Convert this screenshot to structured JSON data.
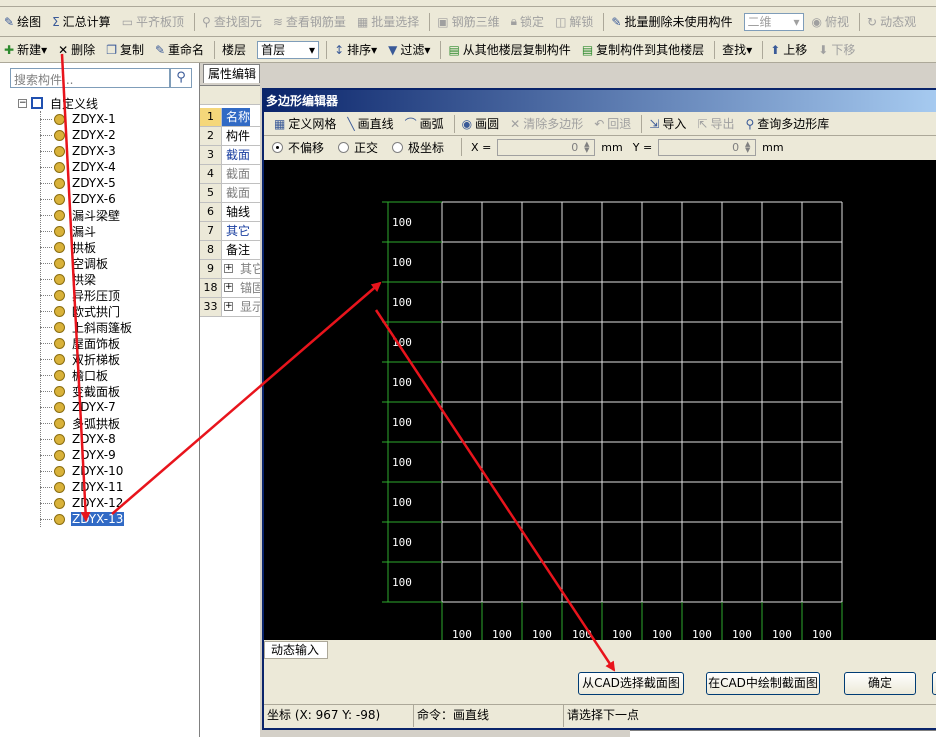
{
  "toolbar1": [
    {
      "name": "draw-button",
      "icon": "pencil-icon",
      "label": "绘图",
      "disabled": false
    },
    {
      "name": "summary-calc-button",
      "icon": "sigma-icon",
      "label": "汇总计算",
      "disabled": false
    },
    {
      "name": "flat-slab-top-button",
      "icon": "slab-icon",
      "label": "平齐板顶",
      "disabled": true
    },
    {
      "name": "find-element-button",
      "icon": "binoculars-icon",
      "label": "查找图元",
      "disabled": true
    },
    {
      "name": "view-rebar-button",
      "icon": "rebar-icon",
      "label": "查看钢筋量",
      "disabled": true
    },
    {
      "name": "batch-select-button",
      "icon": "batch-icon",
      "label": "批量选择",
      "disabled": true
    },
    {
      "name": "rebar-3d-button",
      "icon": "cube-icon",
      "label": "钢筋三维",
      "disabled": true
    },
    {
      "name": "lock-button",
      "icon": "lock-icon",
      "label": "锁定",
      "disabled": true
    },
    {
      "name": "unlock-button",
      "icon": "unlock-icon",
      "label": "解锁",
      "disabled": true
    },
    {
      "name": "batch-delete-unused-button",
      "icon": "delete-batch-icon",
      "label": "批量删除未使用构件",
      "disabled": false
    },
    {
      "name": "view-mode-combo",
      "icon": "",
      "label": "二维",
      "disabled": true,
      "combo": true
    },
    {
      "name": "top-view-button",
      "icon": "eye-icon",
      "label": "俯视",
      "disabled": true
    },
    {
      "name": "dynamic-observe-button",
      "icon": "rotate-icon",
      "label": "动态观",
      "disabled": true
    }
  ],
  "toolbar2": {
    "new_label": "新建",
    "delete_label": "删除",
    "copy_label": "复制",
    "rename_label": "重命名",
    "floor_label": "楼层",
    "floor_value": "首层",
    "sort_label": "排序",
    "filter_label": "过滤",
    "copy_from_floor_label": "从其他楼层复制构件",
    "copy_to_floor_label": "复制构件到其他楼层",
    "find_label": "查找",
    "move_up_label": "上移",
    "move_down_label": "下移"
  },
  "left": {
    "search_placeholder": "搜索构件...",
    "tree_root": "自定义线",
    "items": [
      "ZDYX-1",
      "ZDYX-2",
      "ZDYX-3",
      "ZDYX-4",
      "ZDYX-5",
      "ZDYX-6",
      "漏斗梁壁",
      "漏斗",
      "拱板",
      "空调板",
      "拱梁",
      "异形压顶",
      "欧式拱门",
      "上斜雨篷板",
      "屋面饰板",
      "双折梯板",
      "檐口板",
      "变截面板",
      "ZDYX-7",
      "多弧拱板",
      "ZDYX-8",
      "ZDYX-9",
      "ZDYX-10",
      "ZDYX-11",
      "ZDYX-12",
      "ZDYX-13"
    ],
    "selected_index": 25
  },
  "props": {
    "tab_label": "属性编辑",
    "rows": [
      {
        "num": "1",
        "name": "名称",
        "style": "sel",
        "plus": false
      },
      {
        "num": "2",
        "name": "构件",
        "style": "",
        "plus": false
      },
      {
        "num": "3",
        "name": "截面",
        "style": "blue",
        "plus": false
      },
      {
        "num": "4",
        "name": "截面",
        "style": "gray",
        "plus": false
      },
      {
        "num": "5",
        "name": "截面",
        "style": "gray",
        "plus": false
      },
      {
        "num": "6",
        "name": "轴线",
        "style": "",
        "plus": false
      },
      {
        "num": "7",
        "name": "其它",
        "style": "blue",
        "plus": false
      },
      {
        "num": "8",
        "name": "备注",
        "style": "",
        "plus": false
      },
      {
        "num": "9",
        "name": "其它",
        "style": "gray",
        "plus": true
      },
      {
        "num": "18",
        "name": "锚固",
        "style": "gray",
        "plus": true
      },
      {
        "num": "33",
        "name": "显示",
        "style": "gray",
        "plus": true
      }
    ]
  },
  "dialog": {
    "title": "多边形编辑器",
    "toolbar": [
      {
        "name": "define-grid-button",
        "icon": "grid-icon",
        "label": "定义网格",
        "disabled": false
      },
      {
        "name": "draw-line-button",
        "icon": "line-icon",
        "label": "画直线",
        "disabled": false
      },
      {
        "name": "draw-arc-button",
        "icon": "arc-icon",
        "label": "画弧",
        "disabled": false
      },
      {
        "name": "draw-circle-button",
        "icon": "circle-icon",
        "label": "画圆",
        "disabled": false
      },
      {
        "name": "clear-polygon-button",
        "icon": "close-icon",
        "label": "清除多边形",
        "disabled": true
      },
      {
        "name": "undo-button",
        "icon": "undo-icon",
        "label": "回退",
        "disabled": true
      },
      {
        "name": "import-button",
        "icon": "import-icon",
        "label": "导入",
        "disabled": false
      },
      {
        "name": "export-button",
        "icon": "export-icon",
        "label": "导出",
        "disabled": true
      },
      {
        "name": "query-polygon-lib-button",
        "icon": "search-icon",
        "label": "查询多边形库",
        "disabled": false
      }
    ],
    "options": {
      "no_offset": "不偏移",
      "orthogonal": "正交",
      "polar": "极坐标",
      "x_label": "X =",
      "x_value": "0",
      "y_label": "Y =",
      "y_value": "0",
      "unit": "mm"
    },
    "grid": {
      "rows": 10,
      "cols": 10,
      "row_spacing": [
        "100",
        "100",
        "100",
        "100",
        "100",
        "100",
        "100",
        "100",
        "100",
        "100"
      ],
      "col_spacing": [
        "100",
        "100",
        "100",
        "100",
        "100",
        "100",
        "100",
        "100",
        "100",
        "100"
      ]
    },
    "dynamic_input_tab": "动态输入",
    "buttons": {
      "select_from_cad": "从CAD选择截面图",
      "draw_in_cad": "在CAD中绘制截面图",
      "ok": "确定"
    },
    "status": {
      "coords": "坐标 (X: 967 Y: -98)",
      "command": "命令：画直线",
      "prompt": "请选择下一点"
    }
  },
  "colors": {
    "annotation_arrow": "#e8141c",
    "grid_line": "#e0e0e0",
    "dimension_line": "#2eaa2e",
    "selection": "#316ac5"
  }
}
